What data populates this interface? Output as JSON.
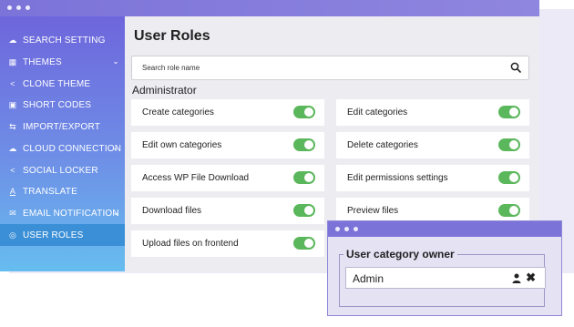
{
  "sidebar": {
    "items": [
      {
        "label": "SEARCH SETTING",
        "icon": "cloud-icon",
        "glyph": "☁",
        "chevron": false,
        "active": false
      },
      {
        "label": "THEMES",
        "icon": "grid-icon",
        "glyph": "▦",
        "chevron": true,
        "active": false
      },
      {
        "label": "CLONE THEME",
        "icon": "share-icon",
        "glyph": "<",
        "chevron": false,
        "active": false
      },
      {
        "label": "SHORT CODES",
        "icon": "briefcase-icon",
        "glyph": "▣",
        "chevron": false,
        "active": false
      },
      {
        "label": "IMPORT/EXPORT",
        "icon": "transfer-icon",
        "glyph": "⇆",
        "chevron": false,
        "active": false
      },
      {
        "label": "CLOUD CONNECTION",
        "icon": "cloud-icon",
        "glyph": "☁",
        "chevron": true,
        "active": false
      },
      {
        "label": "SOCIAL LOCKER",
        "icon": "share-icon",
        "glyph": "<",
        "chevron": false,
        "active": false
      },
      {
        "label": "TRANSLATE",
        "icon": "text-icon",
        "glyph": "A",
        "chevron": false,
        "active": false
      },
      {
        "label": "EMAIL NOTIFICATION",
        "icon": "mail-icon",
        "glyph": "✉",
        "chevron": true,
        "active": false
      },
      {
        "label": "USER ROLES",
        "icon": "user-circle-icon",
        "glyph": "◎",
        "chevron": false,
        "active": true
      }
    ],
    "chevron_glyph": "⌄"
  },
  "main": {
    "title": "User Roles",
    "search_placeholder": "Search role name",
    "section": "Administrator",
    "permissions": [
      {
        "label": "Create categories",
        "enabled": true
      },
      {
        "label": "Edit categories",
        "enabled": true
      },
      {
        "label": "Edit own categories",
        "enabled": true
      },
      {
        "label": "Delete categories",
        "enabled": true
      },
      {
        "label": "Access WP File Download",
        "enabled": true
      },
      {
        "label": "Edit permissions settings",
        "enabled": true
      },
      {
        "label": "Download files",
        "enabled": true
      },
      {
        "label": "Preview files",
        "enabled": true
      },
      {
        "label": "Upload files on frontend",
        "enabled": true
      }
    ]
  },
  "popup": {
    "legend": "User category owner",
    "value": "Admin",
    "clear_glyph": "✖"
  },
  "colors": {
    "accent": "#7c73d9",
    "toggle_on": "#5bb75b",
    "active_nav": "#3b8fd6"
  }
}
